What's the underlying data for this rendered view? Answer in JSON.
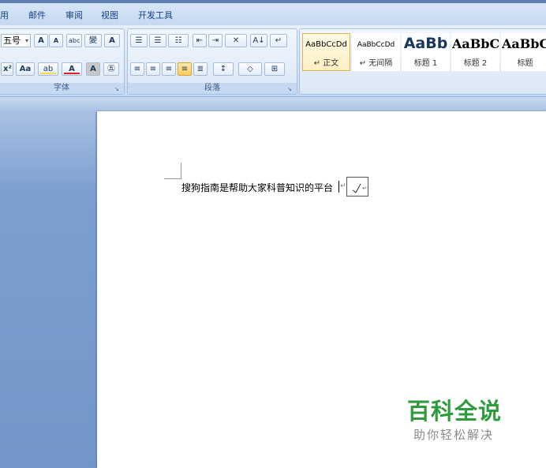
{
  "menu": {
    "tabs": [
      "用",
      "邮件",
      "审阅",
      "视图",
      "开发工具"
    ]
  },
  "font_group": {
    "label": "字体",
    "font_size": "五号",
    "buttons": [
      "A",
      "A",
      "abc",
      "變",
      "A",
      "x²",
      "Aa",
      "ab",
      "A",
      "A",
      "㊄"
    ]
  },
  "paragraph_group": {
    "label": "段落",
    "buttons": [
      "☰",
      "☰",
      "☷",
      "⇤",
      "⇥",
      "✕",
      "A↓",
      "↵",
      "≡",
      "≡",
      "≡",
      "≡",
      "≣",
      "↕",
      "◇",
      "⊞"
    ]
  },
  "styles_group": {
    "tiles": [
      {
        "sample": "AaBbCcDd",
        "name": "↵ 正文"
      },
      {
        "sample": "AaBbCcDd",
        "name": "↵ 无间隔"
      },
      {
        "sample": "AaBb",
        "name": "标题 1"
      },
      {
        "sample": "AaBbC",
        "name": "标题 2"
      },
      {
        "sample": "AaBbC",
        "name": "标题"
      }
    ]
  },
  "document": {
    "text": "搜狗指南是帮助大家科普知识的平台",
    "para_mark": "↵",
    "object_label": "↵"
  },
  "watermark": {
    "title": "百科全说",
    "subtitle": "助你轻松解决"
  },
  "colors": {
    "accent_green": "#2e9b3d",
    "highlight_yellow": "#ffd94d",
    "font_red": "#e02020"
  }
}
